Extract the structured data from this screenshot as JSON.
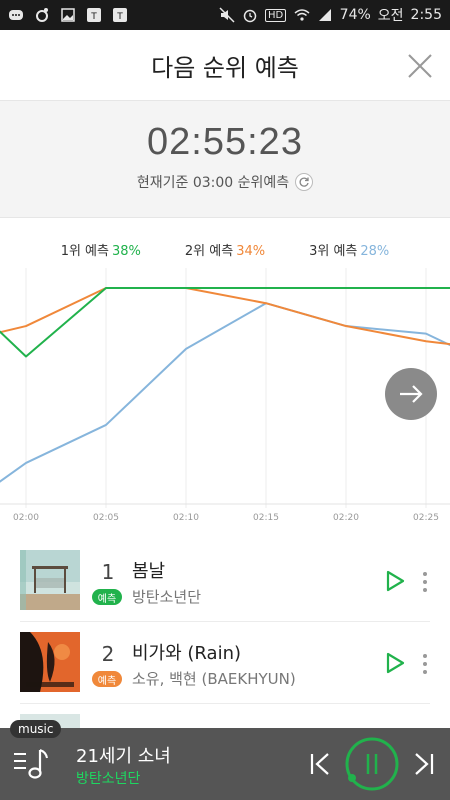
{
  "status_bar": {
    "battery": "74%",
    "ampm": "오전",
    "time": "2:55",
    "icons": [
      "chat-icon",
      "circle-icon",
      "image-icon",
      "talk-icon",
      "talk-icon",
      "mute-icon",
      "alarm-icon",
      "hd-icon",
      "wifi-icon",
      "signal-icon"
    ],
    "hd_label": "HD"
  },
  "header": {
    "title": "다음 순위 예측"
  },
  "timer": {
    "countdown": "02:55:23",
    "basis": "현재기준 03:00 순위예측"
  },
  "legend": [
    {
      "label": "1위 예측",
      "pct": "38%",
      "color": "#21b24c"
    },
    {
      "label": "2위 예측",
      "pct": "34%",
      "color": "#f0883a"
    },
    {
      "label": "3위 예측",
      "pct": "28%",
      "color": "#86b5dc"
    }
  ],
  "chart_data": {
    "type": "line",
    "x": [
      "02:00",
      "02:05",
      "02:10",
      "02:15",
      "02:20",
      "02:25"
    ],
    "xlabel": "",
    "ylabel": "",
    "grid": true,
    "series": [
      {
        "name": "1위 예측",
        "color": "#21b24c",
        "x": [
          "01:58",
          "02:00",
          "02:05",
          "02:10",
          "02:15",
          "02:20",
          "02:25",
          "02:27"
        ],
        "values": [
          33,
          29,
          38,
          38,
          38,
          38,
          38,
          38
        ]
      },
      {
        "name": "2위 예측",
        "color": "#f0883a",
        "x": [
          "01:58",
          "02:00",
          "02:05",
          "02:10",
          "02:15",
          "02:20",
          "02:25",
          "02:27"
        ],
        "values": [
          32,
          33,
          38,
          38,
          36,
          33,
          31,
          30.5
        ]
      },
      {
        "name": "3위 예측",
        "color": "#86b5dc",
        "x": [
          "01:58",
          "02:00",
          "02:05",
          "02:10",
          "02:15",
          "02:20",
          "02:25",
          "02:27"
        ],
        "values": [
          12,
          15,
          20,
          30,
          36,
          33,
          32,
          30
        ]
      }
    ]
  },
  "list": [
    {
      "rank": "1",
      "badge": "예측",
      "badge_color": "#21b24c",
      "song": "봄날",
      "artist": "방탄소년단"
    },
    {
      "rank": "2",
      "badge": "예측",
      "badge_color": "#f0883a",
      "song": "비가와 (Rain)",
      "artist": "소유, 백현 (BAEKHYUN)"
    }
  ],
  "player": {
    "tag": "music",
    "song": "21세기 소녀",
    "artist": "방탄소년단"
  },
  "colors": {
    "accent_green": "#21b24c",
    "accent_orange": "#f0883a",
    "accent_blue": "#86b5dc"
  }
}
